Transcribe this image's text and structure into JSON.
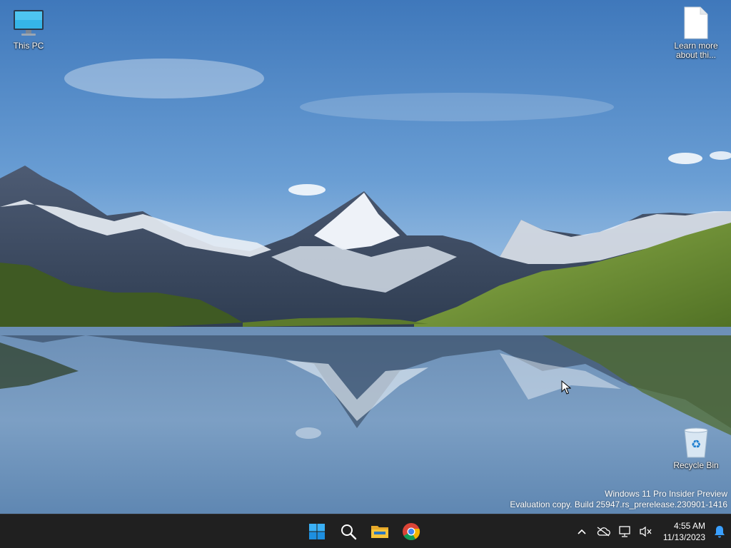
{
  "desktop": {
    "icons": [
      {
        "label": "This PC",
        "icon": "monitor-icon"
      },
      {
        "label": "Learn more\nabout thi...",
        "icon": "document-icon"
      },
      {
        "label": "Recycle Bin",
        "icon": "recycle-bin-icon"
      }
    ]
  },
  "watermark": {
    "line1": "Windows 11 Pro Insider Preview",
    "line2": "Evaluation copy. Build 25947.rs_prerelease.230901-1416"
  },
  "taskbar": {
    "pinned": [
      {
        "name": "Start",
        "icon": "windows-start-icon"
      },
      {
        "name": "Search",
        "icon": "search-icon"
      },
      {
        "name": "File Explorer",
        "icon": "folder-icon"
      },
      {
        "name": "Google Chrome",
        "icon": "chrome-icon"
      }
    ],
    "tray": {
      "icons": [
        "chevron-up-icon",
        "onedrive-offline-icon",
        "network-icon",
        "volume-muted-icon",
        "notification-bell-icon"
      ],
      "time": "4:55 AM",
      "date": "11/13/2023"
    }
  },
  "colors": {
    "taskbar": "#202020",
    "windows_blue": "#0078d4",
    "folder_yellow": "#f5c43a",
    "notification_blue": "#3aa0ff"
  }
}
